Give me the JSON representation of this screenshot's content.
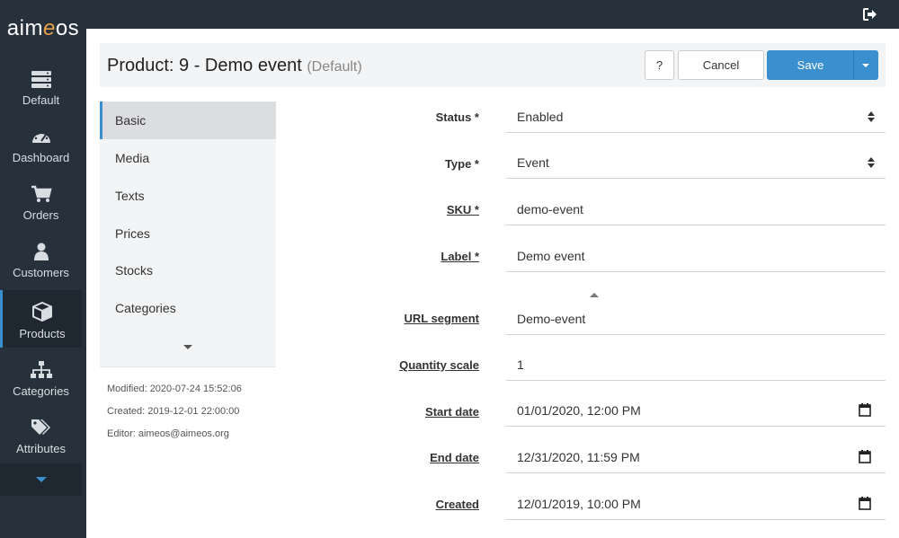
{
  "app": {
    "logo_text": "aim",
    "logo_accent": "e",
    "logo_tail": "os",
    "accent_color": "#3a8fce",
    "sidebar_color": "#27313c"
  },
  "sidebar": {
    "items": [
      {
        "label": "Default",
        "icon": "server-icon"
      },
      {
        "label": "Dashboard",
        "icon": "gauge-icon"
      },
      {
        "label": "Orders",
        "icon": "cart-icon"
      },
      {
        "label": "Customers",
        "icon": "user-icon"
      },
      {
        "label": "Products",
        "icon": "cube-icon",
        "active": true
      },
      {
        "label": "Categories",
        "icon": "sitemap-icon"
      },
      {
        "label": "Attributes",
        "icon": "tags-icon"
      }
    ],
    "more_icon": "caret-down-icon"
  },
  "topbar": {
    "logout_icon": "sign-out-icon"
  },
  "header": {
    "title": "Product: 9 - Demo event",
    "subtitle": "(Default)",
    "help_label": "?",
    "cancel_label": "Cancel",
    "save_label": "Save"
  },
  "tabs": {
    "items": [
      "Basic",
      "Media",
      "Texts",
      "Prices",
      "Stocks",
      "Categories"
    ],
    "active": "Basic"
  },
  "meta": {
    "modified": "Modified: 2020-07-24 15:52:06",
    "created": "Created: 2019-12-01 22:00:00",
    "editor": "Editor: aimeos@aimeos.org"
  },
  "form": {
    "status": {
      "label": "Status *",
      "value": "Enabled"
    },
    "type": {
      "label": "Type *",
      "value": "Event"
    },
    "sku": {
      "label": "SKU *",
      "value": "demo-event"
    },
    "label": {
      "label": "Label *",
      "value": "Demo event"
    },
    "url": {
      "label": "URL segment",
      "value": "Demo-event"
    },
    "qty": {
      "label": "Quantity scale",
      "value": "1"
    },
    "start": {
      "label": "Start date",
      "value": "01/01/2020, 12:00 PM"
    },
    "end": {
      "label": "End date",
      "value": "12/31/2020, 11:59 PM"
    },
    "created": {
      "label": "Created",
      "value": "12/01/2019, 10:00 PM"
    }
  }
}
